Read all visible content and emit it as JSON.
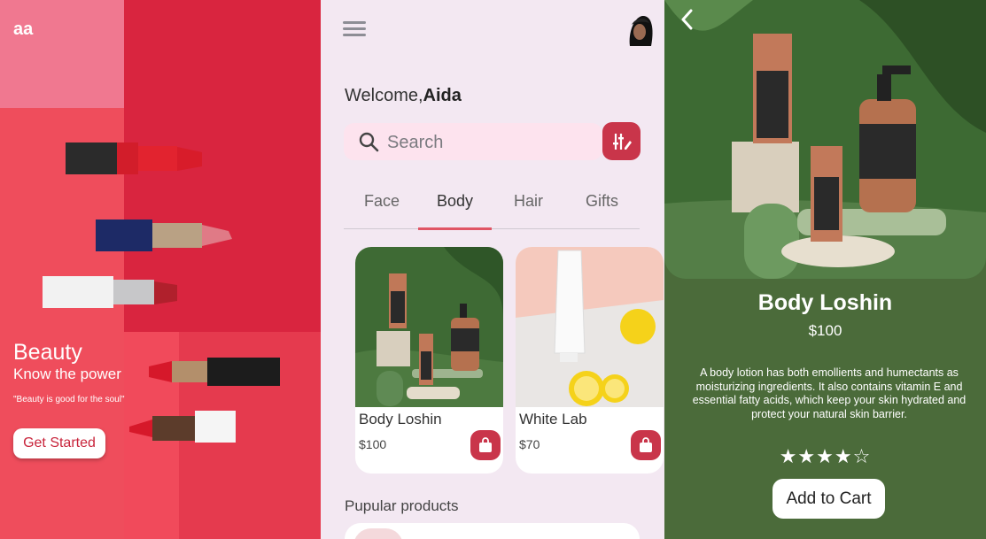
{
  "splash": {
    "logo": "aa",
    "title": "Beauty",
    "subtitle": "Know the power",
    "quote": "\"Beauty is good for the soul\"",
    "cta": "Get Started"
  },
  "home": {
    "welcome_prefix": "Welcome,",
    "user_name": "Aida",
    "search_placeholder": "Search",
    "tabs": [
      "Face",
      "Body",
      "Hair",
      "Gifts"
    ],
    "active_tab": "Body",
    "products": [
      {
        "name": "Body Loshin",
        "price": "$100"
      },
      {
        "name": "White Lab",
        "price": "$70"
      }
    ],
    "popular_title": "Pupular products"
  },
  "detail": {
    "name": "Body Loshin",
    "price": "$100",
    "description": "A body lotion has both emollients and humectants as moisturizing ingredients. It also contains vitamin E and essential fatty acids, which keep your skin hydrated and protect your natural skin barrier.",
    "rating": 4,
    "rating_max": 5,
    "stars": "★★★★☆",
    "cta": "Add to Cart"
  },
  "colors": {
    "brand_red": "#c9354a",
    "detail_green": "#4b6b3a",
    "home_bg": "#f3e8f2"
  },
  "icons": [
    "back-arrow-icon",
    "menu-icon",
    "search-icon",
    "filter-icon",
    "shopping-bag-icon",
    "star-icon"
  ]
}
